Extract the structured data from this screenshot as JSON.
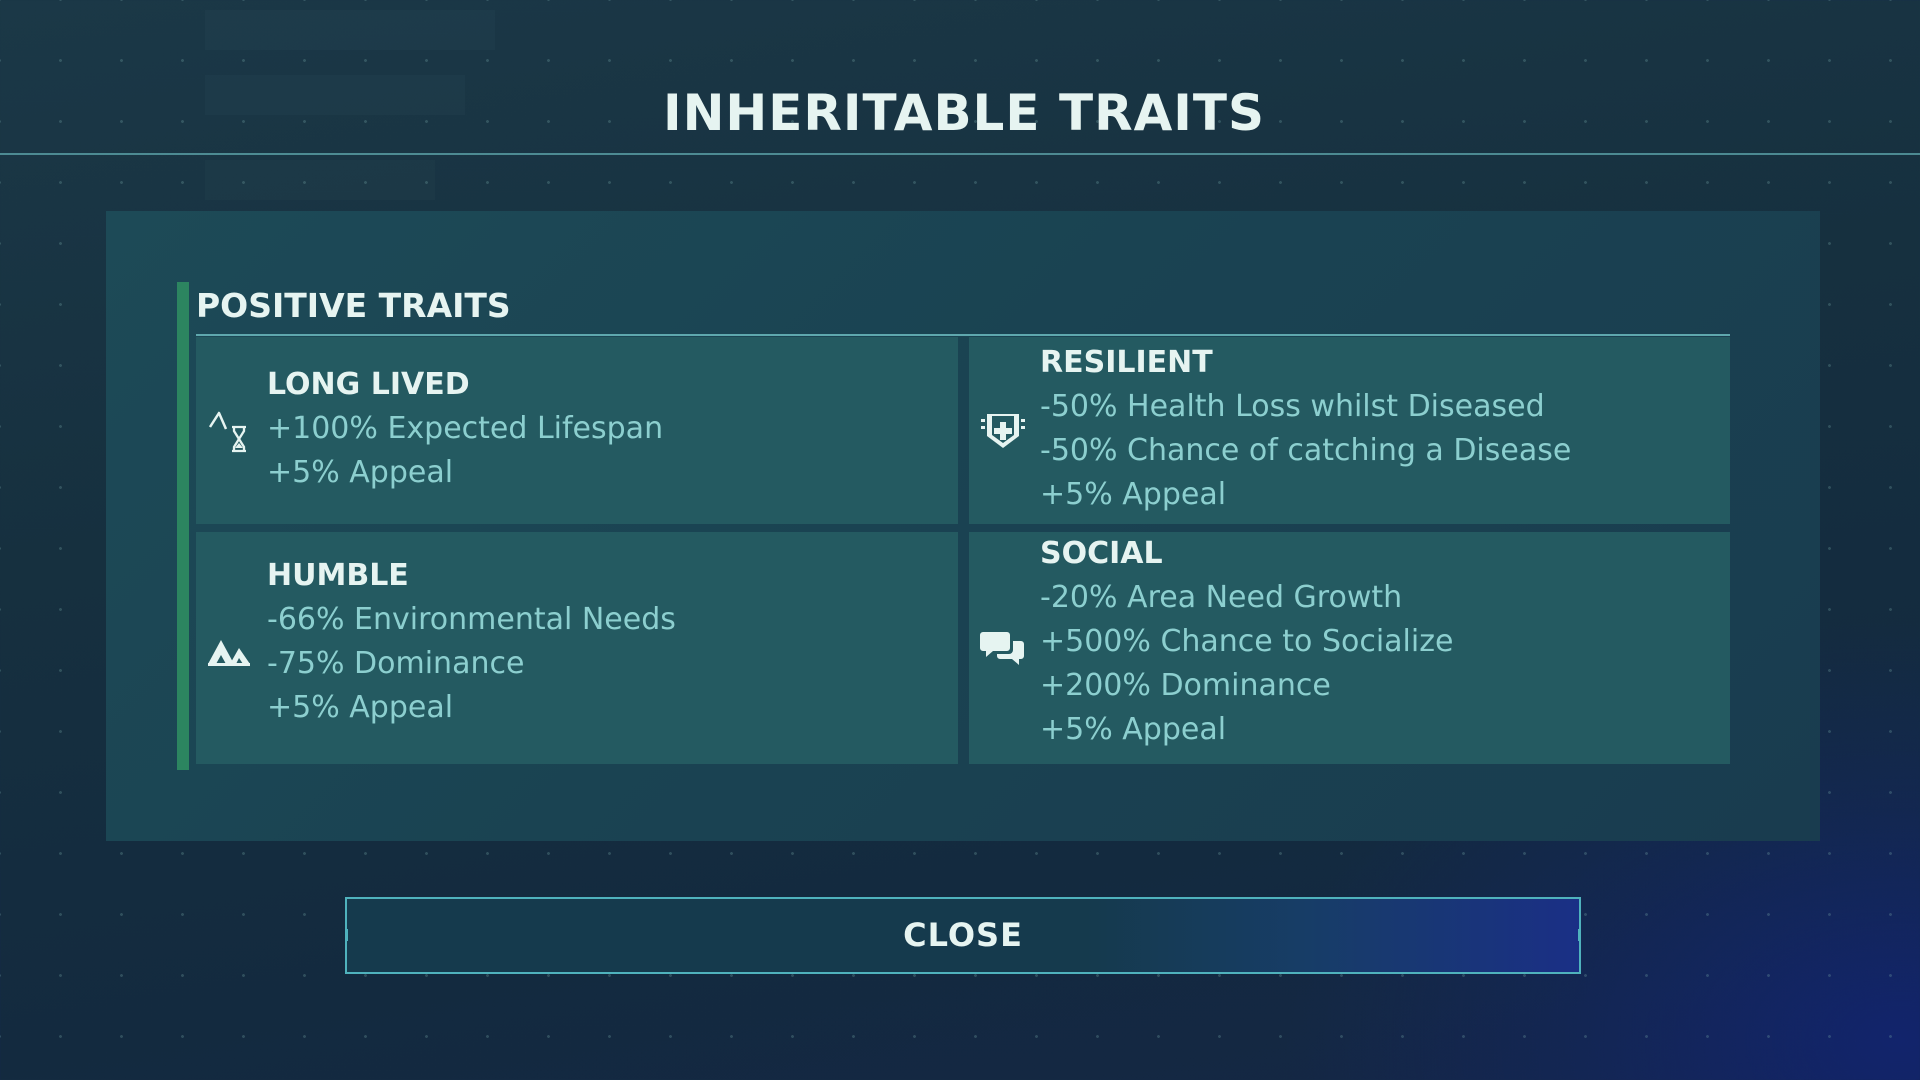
{
  "title": "INHERITABLE TRAITS",
  "section": {
    "label": "POSITIVE TRAITS",
    "accent_color": "#2c8560"
  },
  "traits": [
    {
      "name": "LONG LIVED",
      "icon": "lifespan-hourglass-icon",
      "effects": [
        "+100% Expected Lifespan",
        "+5% Appeal"
      ]
    },
    {
      "name": "RESILIENT",
      "icon": "shield-plus-icon",
      "effects": [
        "-50% Health Loss whilst Diseased",
        "-50% Chance of catching a Disease",
        "+5% Appeal"
      ]
    },
    {
      "name": "HUMBLE",
      "icon": "humble-mountain-icon",
      "effects": [
        "-66% Environmental Needs",
        "-75% Dominance",
        "+5% Appeal"
      ]
    },
    {
      "name": "SOCIAL",
      "icon": "speech-bubbles-icon",
      "effects": [
        "-20% Area Need Growth",
        "+500% Chance to Socialize",
        "+200% Dominance",
        "+5% Appeal"
      ]
    }
  ],
  "close_button": {
    "label": "CLOSE"
  },
  "colors": {
    "title_text": "#e6f4f1",
    "effect_text": "#8ccfcf",
    "trait_background": "#245a61",
    "button_border": "#4fb2bd"
  }
}
